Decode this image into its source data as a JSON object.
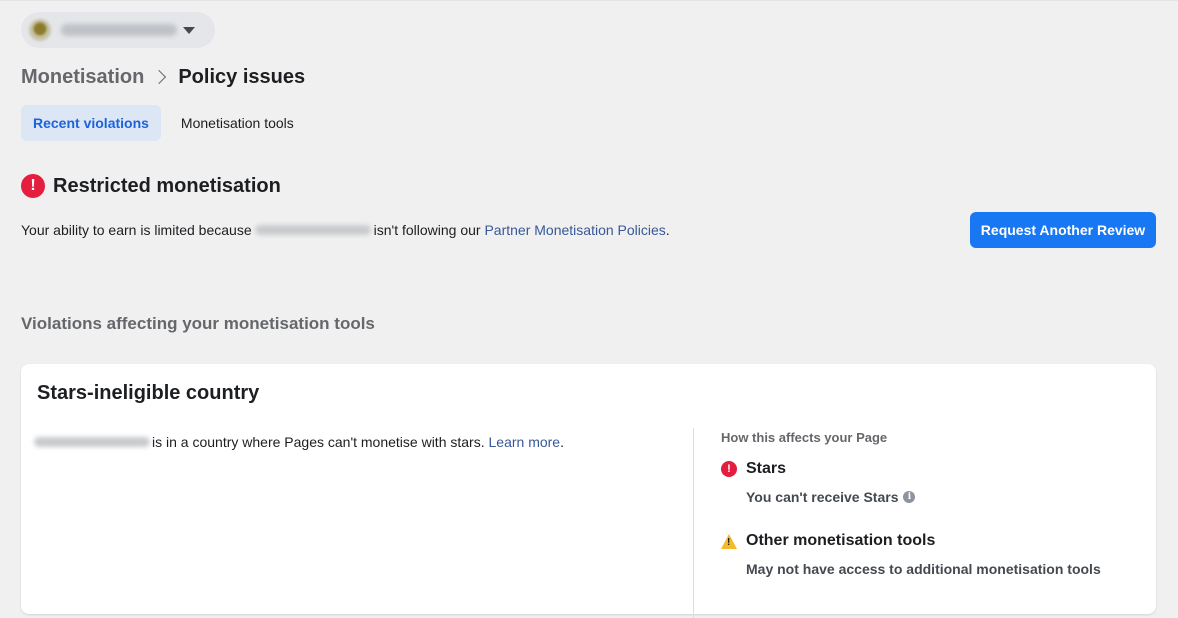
{
  "page_selector": {
    "name": "",
    "dropdown_icon": "caret-down-icon"
  },
  "breadcrumb": {
    "parent": "Monetisation",
    "current": "Policy issues",
    "separator_icon": "chevron-right-icon"
  },
  "tabs": [
    {
      "label": "Recent violations",
      "active": true
    },
    {
      "label": "Monetisation tools",
      "active": false
    }
  ],
  "status": {
    "icon": "alert-circle-icon",
    "title": "Restricted monetisation",
    "description_prefix": "Your ability to earn is limited because",
    "description_mid": "isn't following our",
    "policy_link": "Partner Monetisation Policies",
    "description_suffix": ".",
    "request_button": "Request Another Review"
  },
  "violations": {
    "heading": "Violations affecting your monetisation tools",
    "cards": [
      {
        "title": "Stars-ineligible country",
        "description": "is in a country where Pages can't monetise with stars.",
        "learn_more": "Learn more",
        "learn_more_suffix": ".",
        "affects_heading": "How this affects your Page",
        "effects": [
          {
            "icon": "alert-circle-icon",
            "title": "Stars",
            "detail": "You can't receive Stars",
            "info_icon": "info-icon"
          },
          {
            "icon": "warning-triangle-icon",
            "title": "Other monetisation tools",
            "detail": "May not have access to additional monetisation tools"
          }
        ]
      }
    ]
  },
  "colors": {
    "accent": "#1877f2",
    "link": "#385898",
    "error": "#e41e3f",
    "warning": "#f7b928",
    "tab_active_bg": "#dce6f5"
  }
}
